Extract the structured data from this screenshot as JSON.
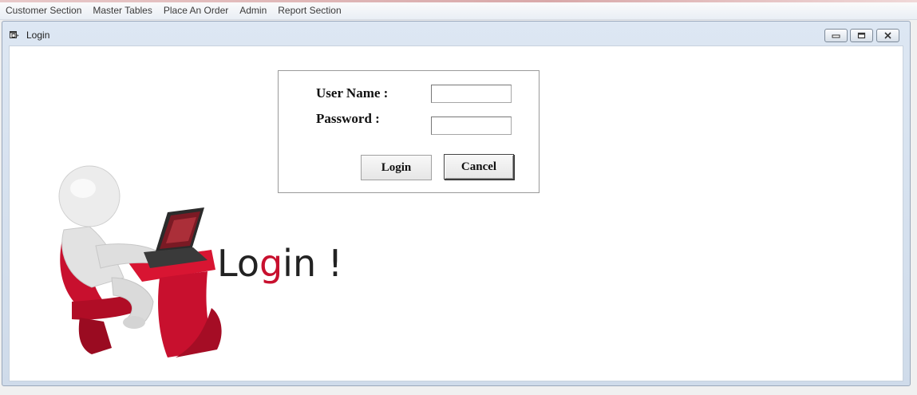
{
  "menu": {
    "items": [
      {
        "label": "Customer Section"
      },
      {
        "label": "Master Tables"
      },
      {
        "label": "Place An Order"
      },
      {
        "label": "Admin"
      },
      {
        "label": "Report Section"
      }
    ]
  },
  "window": {
    "title": "Login",
    "icon": "form-window-icon",
    "controls": [
      "minimize-icon",
      "restore-icon",
      "close-icon"
    ]
  },
  "form": {
    "username_label": "User Name :",
    "username_value": "",
    "password_label": "Password :",
    "password_value": "",
    "login_button": "Login",
    "cancel_button": "Cancel"
  },
  "illustration": {
    "caption": "Login !",
    "accent_color": "#c8102e"
  }
}
